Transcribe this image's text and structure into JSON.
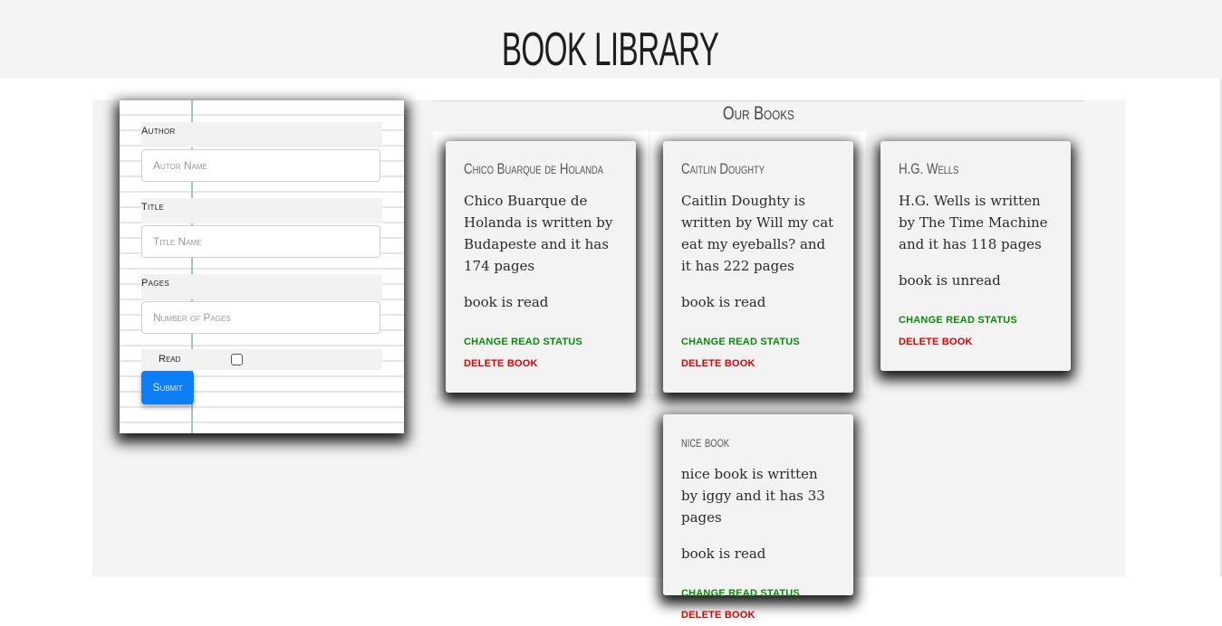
{
  "header": {
    "title": "BOOK LIBRARY"
  },
  "form": {
    "author": {
      "label": "Author",
      "placeholder": "Autor Name"
    },
    "title": {
      "label": "Title",
      "placeholder": "Title Name"
    },
    "pages": {
      "label": "Pages",
      "placeholder": "Number of Pages"
    },
    "read": {
      "label": "Read",
      "checked": false
    },
    "submit_label": "Submit"
  },
  "books_section": {
    "heading": "Our Books"
  },
  "actions": {
    "change_status": "CHANGE READ STATUS",
    "delete": "DELETE BOOK"
  },
  "books": [
    {
      "title": "Chico Buarque de Holanda",
      "description": "Chico Buarque de Holanda is written by Budapeste and it has 174 pages",
      "status": "book is read"
    },
    {
      "title": "Caitlin Doughty",
      "description": "Caitlin Doughty is written by Will my cat eat my eyeballs? and it has 222 pages",
      "status": "book is read"
    },
    {
      "title": "H.G. Wells",
      "description": "H.G. Wells is written by The Time Machine and it has 118 pages",
      "status": "book is unread"
    },
    {
      "title": "nice book",
      "description": "nice book is written by iggy and it has 33 pages",
      "status": "book is read"
    }
  ],
  "colors": {
    "submit": "#0d7ef5",
    "change_status": "#0a8a0a",
    "delete": "#e00000",
    "page_bg": "#f4f4f4"
  }
}
